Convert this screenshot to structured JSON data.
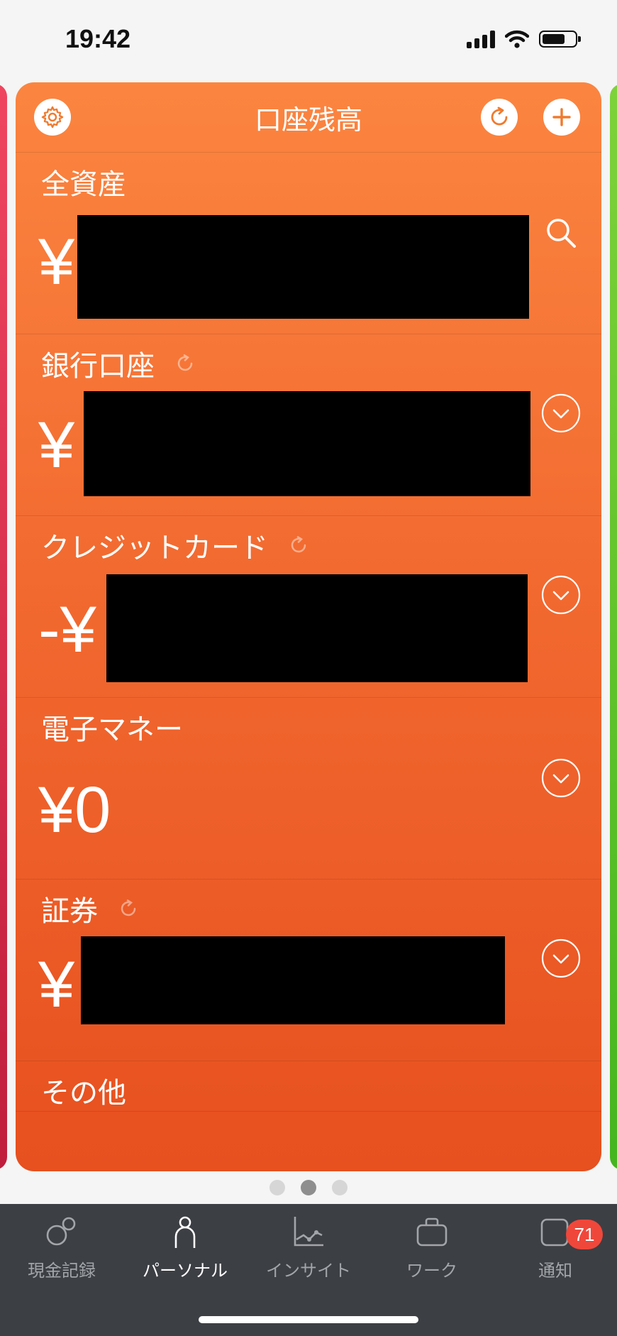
{
  "status_bar": {
    "time": "19:42"
  },
  "header": {
    "title": "口座残高"
  },
  "sections": [
    {
      "label": "全資産",
      "prefix": "¥"
    },
    {
      "label": "銀行口座",
      "prefix": "¥"
    },
    {
      "label": "クレジットカード",
      "prefix": "-¥"
    },
    {
      "label": "電子マネー",
      "amount": "¥0"
    },
    {
      "label": "証券",
      "prefix": "¥"
    },
    {
      "label": "その他"
    }
  ],
  "tabs": [
    {
      "label": "現金記録"
    },
    {
      "label": "パーソナル"
    },
    {
      "label": "インサイト"
    },
    {
      "label": "ワーク"
    },
    {
      "label": "通知",
      "badge": "71"
    }
  ],
  "colors": {
    "card_top": "#fb8540",
    "card_bottom": "#e7501f",
    "accent": "#f07a2e",
    "badge": "#f0473b"
  }
}
